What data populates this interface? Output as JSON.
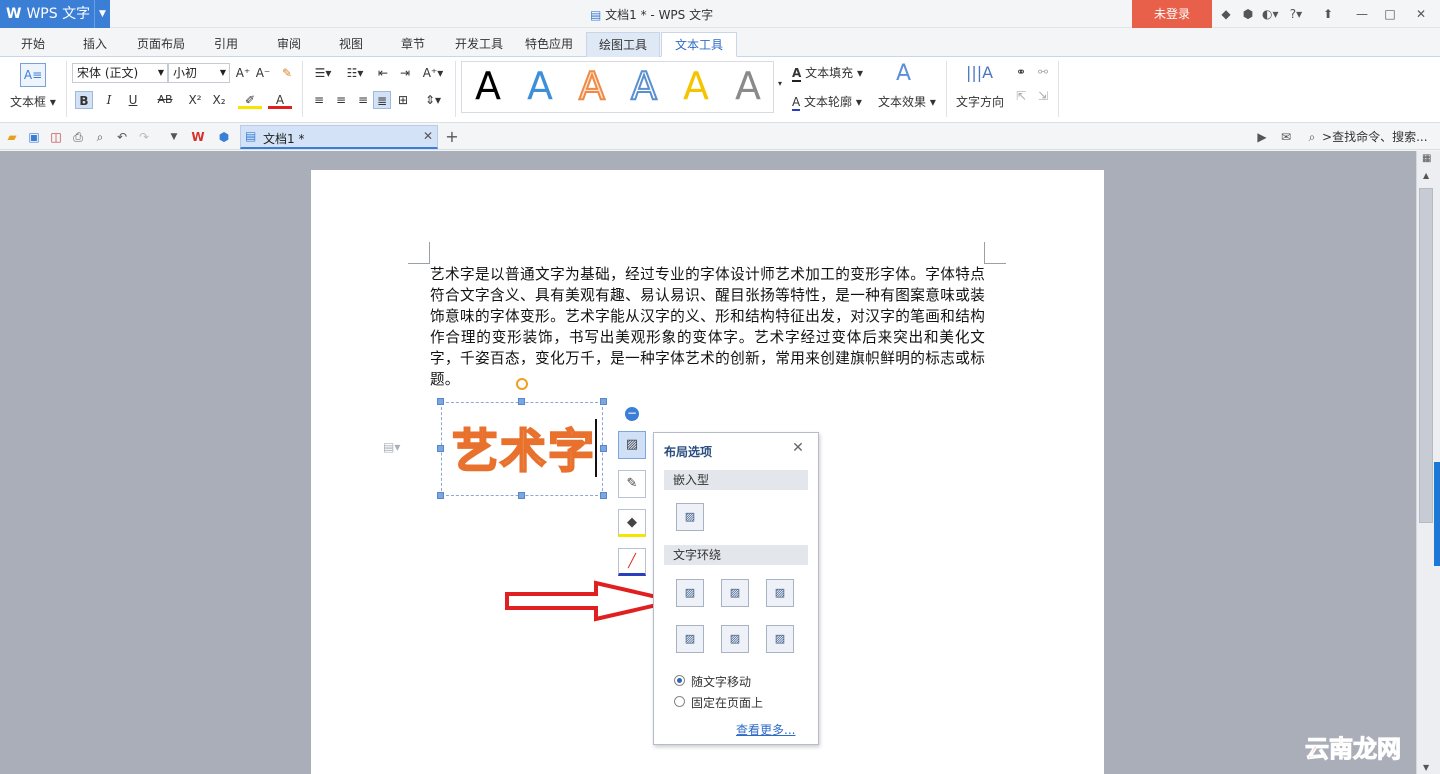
{
  "app": {
    "name": "WPS 文字",
    "window_title": "文档1 * - WPS 文字",
    "login": "未登录"
  },
  "ribbon_tabs": [
    "开始",
    "插入",
    "页面布局",
    "引用",
    "审阅",
    "视图",
    "章节",
    "开发工具",
    "特色应用",
    "绘图工具",
    "文本工具"
  ],
  "active_tab": "文本工具",
  "ribbon": {
    "textbox_label": "文本框",
    "font_name": "宋体 (正文)",
    "font_size": "小初",
    "bold": "B",
    "italic": "I",
    "underline": "U",
    "strike": "AB",
    "superscript": "X²",
    "subscript": "X₂",
    "text_fill": "文本填充",
    "text_outline": "文本轮廓",
    "text_effect": "文本效果",
    "text_direction": "文字方向",
    "style_colors": [
      "#000000",
      "#3f8fd8",
      "#f08a46",
      "#5a8fd0",
      "#f5c400",
      "#8a8a8a"
    ]
  },
  "qat": {
    "doc_tab": "文档1 *",
    "search": "查找命令、搜索..."
  },
  "document": {
    "paragraph": "艺术字是以普通文字为基础，经过专业的字体设计师艺术加工的变形字体。字体特点符合文字含义、具有美观有趣、易认易识、醒目张扬等特性，是一种有图案意味或装饰意味的字体变形。艺术字能从汉字的义、形和结构特征出发，对汉字的笔画和结构作合理的变形装饰，书写出美观形象的变体字。艺术字经过变体后来突出和美化文字，千姿百态，变化万千，是一种字体艺术的创新，常用来创建旗帜鲜明的标志或标题。",
    "wordart": "艺术字"
  },
  "layout_popup": {
    "title": "布局选项",
    "section_inline": "嵌入型",
    "section_wrap": "文字环绕",
    "option_move": "随文字移动",
    "option_fixed": "固定在页面上",
    "more_link": "查看更多..."
  },
  "watermark": "云南龙网"
}
